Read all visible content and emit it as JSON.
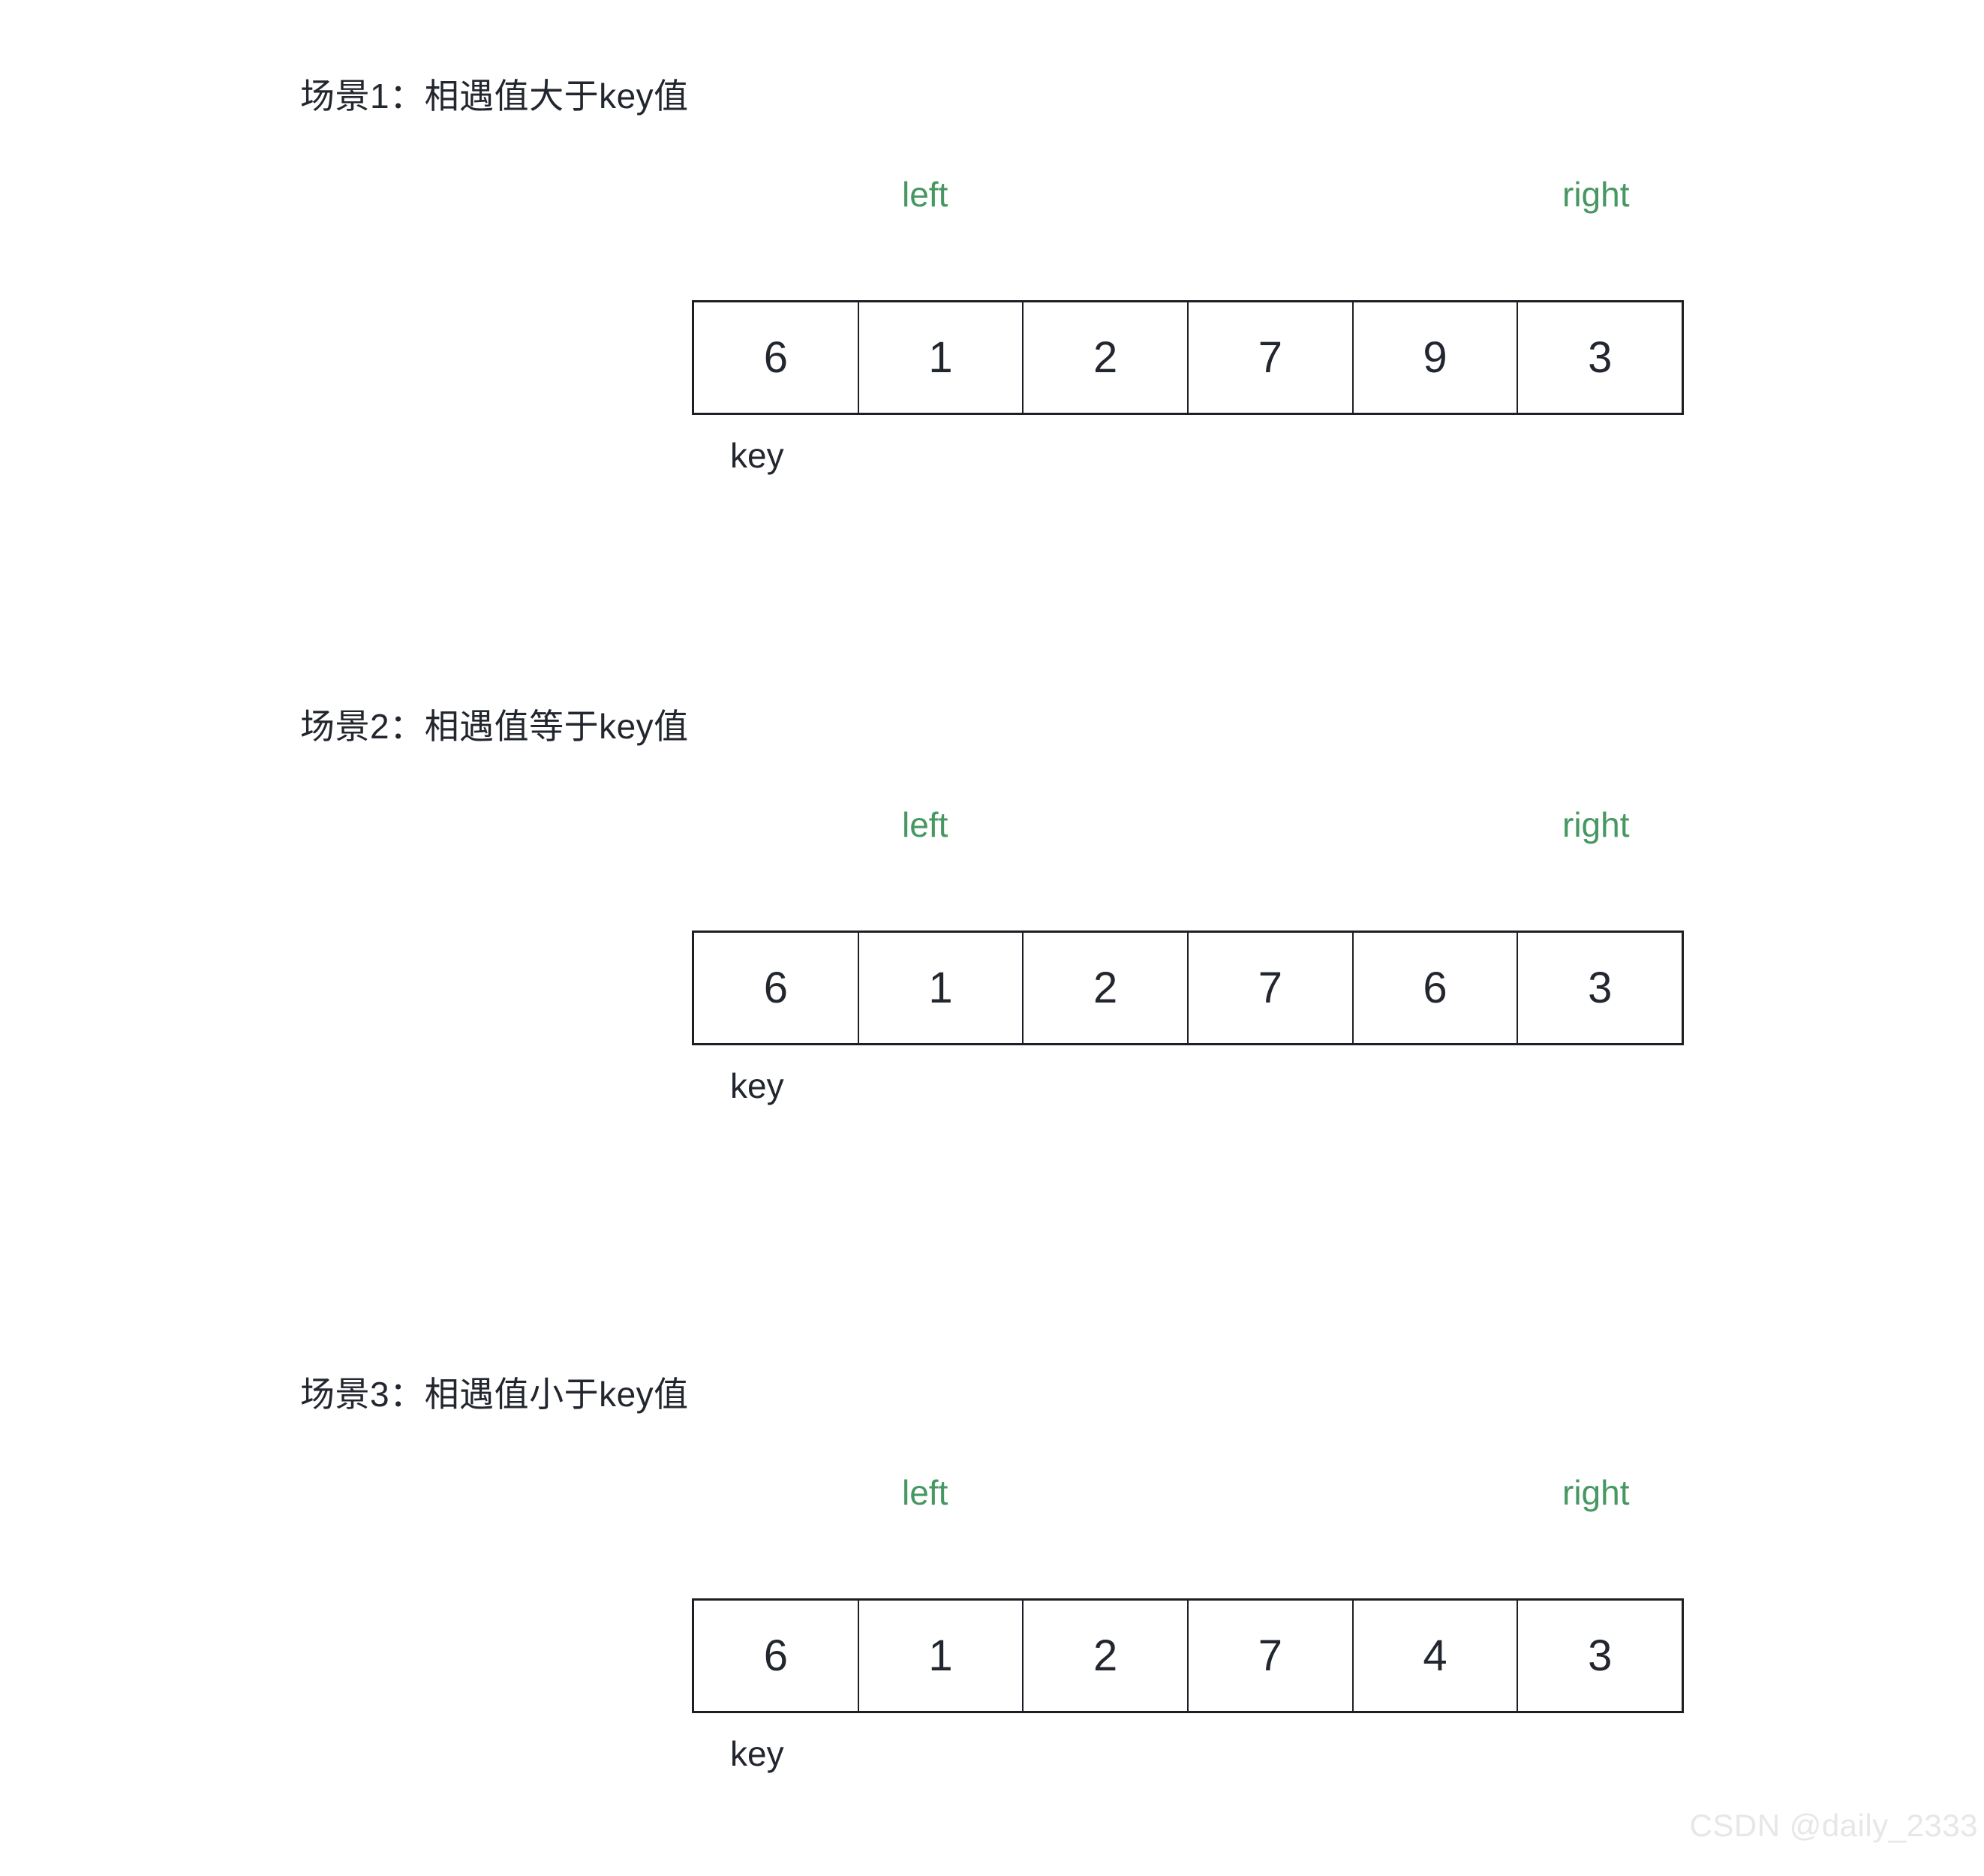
{
  "page": {
    "background_color": "#ffffff",
    "text_color": "#22262e",
    "pointer_color": "#469762",
    "border_color": "#1d1f24",
    "watermark_color": "#e7e7e8"
  },
  "watermark": {
    "text": "CSDN @daily_2333"
  },
  "labels": {
    "left_pointer": "left",
    "right_pointer": "right",
    "key": "key"
  },
  "scenarios": [
    {
      "id": "scenario-1",
      "title": "场景1：相遇值大于key值",
      "left_label": "left",
      "right_label": "right",
      "key_label": "key",
      "cells": [
        "6",
        "1",
        "2",
        "7",
        "9",
        "3"
      ]
    },
    {
      "id": "scenario-2",
      "title": "场景2：相遇值等于key值",
      "left_label": "left",
      "right_label": "right",
      "key_label": "key",
      "cells": [
        "6",
        "1",
        "2",
        "7",
        "6",
        "3"
      ]
    },
    {
      "id": "scenario-3",
      "title": "场景3：相遇值小于key值",
      "left_label": "left",
      "right_label": "right",
      "key_label": "key",
      "cells": [
        "6",
        "1",
        "2",
        "7",
        "4",
        "3"
      ]
    }
  ]
}
